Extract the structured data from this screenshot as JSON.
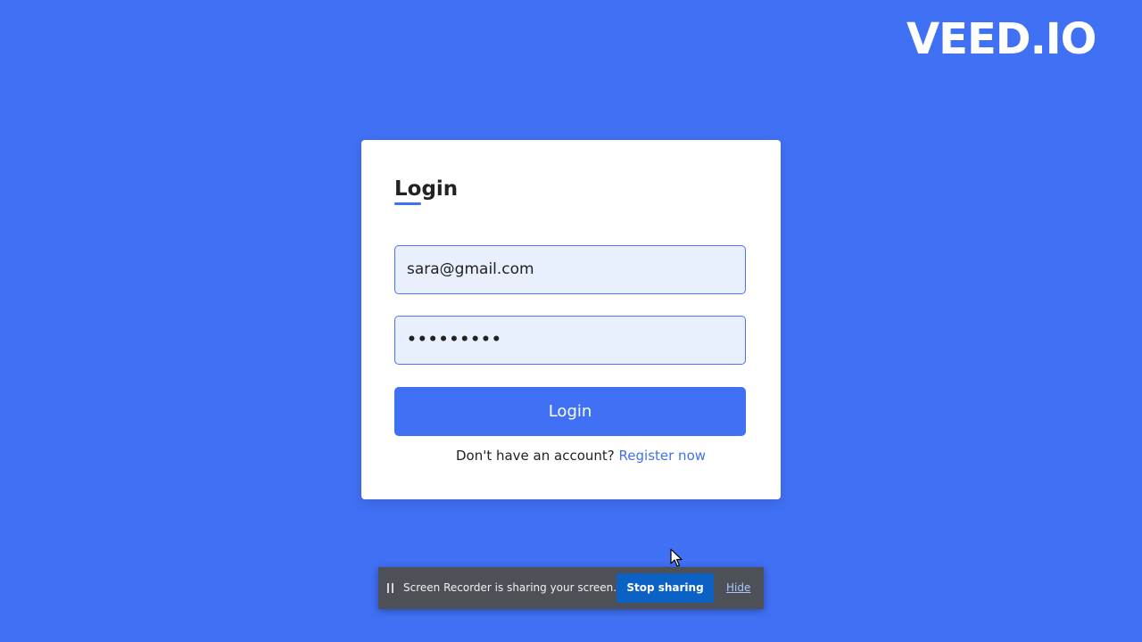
{
  "watermark": {
    "text": "VEED.IO"
  },
  "login_card": {
    "title": "Login",
    "email_value": "sara@gmail.com",
    "password_value": "•••••••••",
    "login_button_label": "Login",
    "signup_prompt": "Don't have an account?",
    "register_link_label": "Register now"
  },
  "share_bar": {
    "message": "Screen Recorder is sharing your screen.",
    "stop_label": "Stop sharing",
    "hide_label": "Hide",
    "pause_icon": "pause-icon"
  },
  "colors": {
    "background": "#4070f4",
    "accent": "#4070f4",
    "input_fill": "#e8f0fe",
    "share_bar": "#4d5157",
    "stop_button": "#0b62c4"
  },
  "pointer": {
    "icon": "mouse-cursor-icon"
  }
}
